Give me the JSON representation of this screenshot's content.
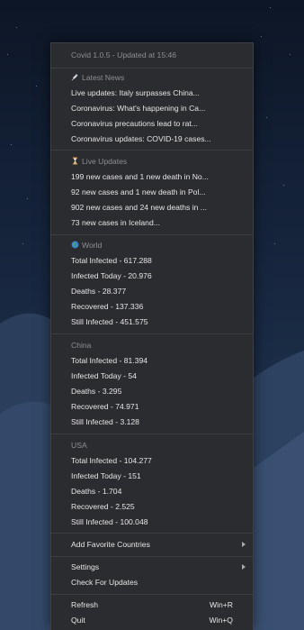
{
  "menu": {
    "title": "Covid 1.0.5 - Updated at 15:46",
    "news": {
      "header": "Latest News",
      "items": [
        "Live updates: Italy surpasses China...",
        "Coronavirus: What's happening in Ca...",
        "Coronavirus precautions lead to rat...",
        "Coronavirus updates: COVID-19 cases..."
      ]
    },
    "live": {
      "header": "Live Updates",
      "items": [
        "199 new cases and 1 new death in No...",
        "92 new cases and 1 new death in Pol...",
        "902 new cases and 24 new deaths in ...",
        "73 new cases in Iceland..."
      ]
    },
    "world": {
      "header": "World",
      "items": [
        "Total Infected - 617.288",
        "Infected Today - 20.976",
        "Deaths - 28.377",
        "Recovered - 137.336",
        "Still Infected - 451.575"
      ]
    },
    "china": {
      "header": "China",
      "items": [
        "Total Infected - 81.394",
        "Infected Today - 54",
        "Deaths - 3.295",
        "Recovered - 74.971",
        "Still Infected - 3.128"
      ]
    },
    "usa": {
      "header": "USA",
      "items": [
        "Total Infected - 104.277",
        "Infected Today - 151",
        "Deaths - 1.704",
        "Recovered - 2.525",
        "Still Infected - 100.048"
      ]
    },
    "favorites_label": "Add Favorite Countries",
    "settings_label": "Settings",
    "check_updates_label": "Check For Updates",
    "refresh_label": "Refresh",
    "refresh_shortcut": "Win+R",
    "quit_label": "Quit",
    "quit_shortcut": "Win+Q"
  },
  "icons": {
    "news": "syringe-icon",
    "live": "hourglass-icon",
    "world": "globe-icon",
    "submenu": "chevron-right-icon"
  },
  "colors": {
    "menu_bg": "#2b2c2f",
    "separator": "#3d3e42",
    "header_text": "#8d8e91",
    "item_text": "#e6e6e6"
  }
}
